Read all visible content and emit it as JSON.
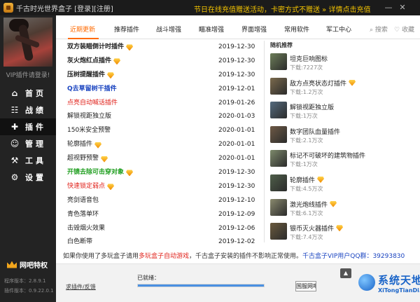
{
  "titlebar": {
    "title": "千古时光世界盒子 [登录][注册]",
    "promo": "节日在线充值赠送活动，卡密方式不赠送 » 详情点击充值"
  },
  "sidebar": {
    "vip_tip": "VIP插件请登录!",
    "items": [
      {
        "label": "首页",
        "icon": "home-icon"
      },
      {
        "label": "战绩",
        "icon": "record-icon"
      },
      {
        "label": "插件",
        "icon": "puzzle-icon"
      },
      {
        "label": "管理",
        "icon": "user-manage-icon"
      },
      {
        "label": "工具",
        "icon": "wrench-icon"
      },
      {
        "label": "设置",
        "icon": "gear-icon"
      }
    ],
    "vip_label": "网吧特权",
    "program_version": "程序版本：2.8.9.1",
    "plugin_version": "插件版本：0.9.22.0.1"
  },
  "tabs": [
    "近期更新",
    "推荐插件",
    "战斗增强",
    "瞄准增强",
    "界面增强",
    "常用软件",
    "军工中心"
  ],
  "toolbar": {
    "search": "搜索",
    "collect": "收藏"
  },
  "plugins": [
    {
      "name": "双方装瞄倒计时插件",
      "date": "2019-12-30",
      "gem": true,
      "color": "#222222",
      "bold": true
    },
    {
      "name": "灰火炮红点插件",
      "date": "2019-12-30",
      "gem": true,
      "color": "#222222",
      "bold": true
    },
    {
      "name": "压树提醒插件",
      "date": "2019-12-30",
      "gem": true,
      "color": "#222222",
      "bold": true
    },
    {
      "name": "Q去草留树干插件",
      "date": "2019-12-01",
      "gem": false,
      "color": "#1a44c0",
      "bold": true
    },
    {
      "name": "点亮自动喊话插件",
      "date": "2019-01-26",
      "gem": false,
      "color": "#e0211a",
      "bold": false
    },
    {
      "name": "解锁视距独立版",
      "date": "2020-01-03",
      "gem": false,
      "color": "#222222",
      "bold": false
    },
    {
      "name": "150米安全预警",
      "date": "2020-01-01",
      "gem": false,
      "color": "#222222",
      "bold": false
    },
    {
      "name": "轮廓插件",
      "date": "2020-01-01",
      "gem": true,
      "color": "#222222",
      "bold": false
    },
    {
      "name": "超视野预警",
      "date": "2020-01-01",
      "gem": true,
      "color": "#222222",
      "bold": false
    },
    {
      "name": "开镜去除可击穿对象",
      "date": "2019-12-30",
      "gem": true,
      "color": "#1f9e1f",
      "bold": true
    },
    {
      "name": "快速锁定弱点",
      "date": "2019-12-30",
      "gem": true,
      "color": "#e0211a",
      "bold": false
    },
    {
      "name": "亮剑语音包",
      "date": "2019-12-10",
      "gem": false,
      "color": "#222222",
      "bold": false
    },
    {
      "name": "青色落单环",
      "date": "2019-12-09",
      "gem": false,
      "color": "#222222",
      "bold": false
    },
    {
      "name": "击毁烟火效果",
      "date": "2019-12-06",
      "gem": false,
      "color": "#222222",
      "bold": false
    },
    {
      "name": "白色断带",
      "date": "2019-12-02",
      "gem": false,
      "color": "#222222",
      "bold": false
    }
  ],
  "recommend": {
    "title": "随机推荐",
    "items": [
      {
        "name": "坦克巨响图标",
        "downloads": "下载:7227次",
        "gem": false,
        "thumb": "#6d7e59"
      },
      {
        "name": "敌方点亮状态灯插件",
        "downloads": "下载:1.2万次",
        "gem": true,
        "thumb": "#7b6a4d"
      },
      {
        "name": "解锁视距独立版",
        "downloads": "下载:1万次",
        "gem": false,
        "thumb": "#556b7e"
      },
      {
        "name": "数字团队血量插件",
        "downloads": "下载:2.1万次",
        "gem": false,
        "thumb": "#6e5a46"
      },
      {
        "name": "标记不可破坏的建筑物插件",
        "downloads": "下载:1万次",
        "gem": false,
        "thumb": "#7d8a6b"
      },
      {
        "name": "轮廓插件",
        "downloads": "下载:4.5万次",
        "gem": true,
        "thumb": "#4f5f4a"
      },
      {
        "name": "激光炮线插件",
        "downloads": "下载:6.1万次",
        "gem": true,
        "thumb": "#8a8a6e"
      },
      {
        "name": "银币灭火器插件",
        "downloads": "下载:7.4万次",
        "gem": true,
        "thumb": "#6a5a3e"
      }
    ]
  },
  "notice": {
    "part1": "如果你使用了多玩盒子请用",
    "red": "多玩盒子自动游戏",
    "part2": "，千古盒子安装的插件不影响正常使用。",
    "blue": "千古盒子VIP用户QQ群：39293830"
  },
  "bottom": {
    "feedback": "求插件/反馈",
    "ready": "已就绪：",
    "progress": 1.0,
    "cafe_button": "国服网吧",
    "arrow": "▲",
    "watermark_cn": "系统天地",
    "watermark_en": "XiTongTianDi.net"
  }
}
